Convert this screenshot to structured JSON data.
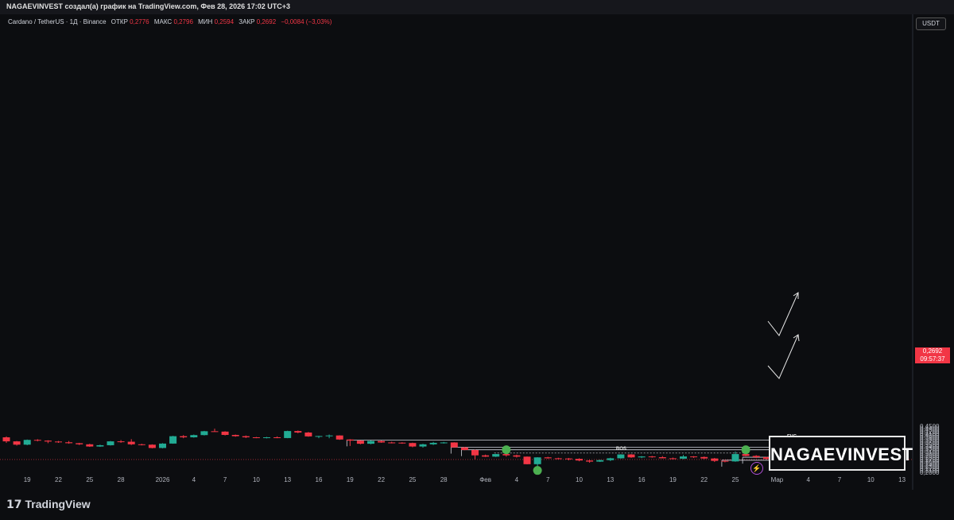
{
  "header": {
    "attribution": "NAGAEVINVEST создал(а) график на TradingView.com, Фев 28, 2026 17:02 UTC+3"
  },
  "legend": {
    "symbol": "Cardano / TetherUS · 1Д · Binance",
    "open_label": "ОТКР",
    "open_value": "0,2776",
    "high_label": "МАКС",
    "high_value": "0,2796",
    "low_label": "МИН",
    "low_value": "0,2594",
    "close_label": "ЗАКР",
    "close_value": "0,2692",
    "change": "−0,0084 (−3,03%)"
  },
  "price_axis": {
    "currency": "USDT",
    "last_price": "0,2692",
    "countdown": "09:57:37"
  },
  "watermark": "NAGAEVINVEST",
  "footer": {
    "brand": "TradingView"
  },
  "colors": {
    "up": "#22ab94",
    "down": "#f23645",
    "background": "#0c0d10",
    "marker": "#4caf50"
  },
  "chart_data": {
    "type": "candlestick",
    "timeframe": "1D",
    "y_ticks": [
      "0,2000",
      "0,2100",
      "0,2200",
      "0,2300",
      "0,2400",
      "0,2500",
      "0,2600",
      "0,2700",
      "0,2800",
      "0,2900",
      "0,3000",
      "0,3100",
      "0,3200",
      "0,3300",
      "0,3400",
      "0,3500",
      "0,3600",
      "0,3700",
      "0,3800",
      "0,3900",
      "0,4000",
      "0,4100",
      "0,4200",
      "0,4300",
      "0,4400",
      "0,4500"
    ],
    "ylim": [
      0.2,
      0.455
    ],
    "x_ticks": [
      {
        "i": 2,
        "label": "19"
      },
      {
        "i": 5,
        "label": "22"
      },
      {
        "i": 8,
        "label": "25"
      },
      {
        "i": 11,
        "label": "28"
      },
      {
        "i": 15,
        "label": "2026"
      },
      {
        "i": 18,
        "label": "4"
      },
      {
        "i": 21,
        "label": "7"
      },
      {
        "i": 24,
        "label": "10"
      },
      {
        "i": 27,
        "label": "13"
      },
      {
        "i": 30,
        "label": "16"
      },
      {
        "i": 33,
        "label": "19"
      },
      {
        "i": 36,
        "label": "22"
      },
      {
        "i": 39,
        "label": "25"
      },
      {
        "i": 42,
        "label": "28"
      },
      {
        "i": 46,
        "label": "Фев"
      },
      {
        "i": 49,
        "label": "4"
      },
      {
        "i": 52,
        "label": "7"
      },
      {
        "i": 55,
        "label": "10"
      },
      {
        "i": 58,
        "label": "13"
      },
      {
        "i": 61,
        "label": "16"
      },
      {
        "i": 64,
        "label": "19"
      },
      {
        "i": 67,
        "label": "22"
      },
      {
        "i": 70,
        "label": "25"
      },
      {
        "i": 74,
        "label": "Мар"
      },
      {
        "i": 77,
        "label": "4"
      },
      {
        "i": 80,
        "label": "7"
      },
      {
        "i": 83,
        "label": "10"
      },
      {
        "i": 86,
        "label": "13"
      }
    ],
    "candles": [
      [
        0.39,
        0.395,
        0.36,
        0.368
      ],
      [
        0.368,
        0.37,
        0.345,
        0.35
      ],
      [
        0.35,
        0.378,
        0.347,
        0.376
      ],
      [
        0.376,
        0.38,
        0.368,
        0.372
      ],
      [
        0.372,
        0.374,
        0.358,
        0.367
      ],
      [
        0.367,
        0.37,
        0.36,
        0.363
      ],
      [
        0.363,
        0.37,
        0.355,
        0.358
      ],
      [
        0.358,
        0.36,
        0.348,
        0.352
      ],
      [
        0.352,
        0.355,
        0.338,
        0.34
      ],
      [
        0.34,
        0.35,
        0.338,
        0.347
      ],
      [
        0.347,
        0.37,
        0.345,
        0.368
      ],
      [
        0.368,
        0.375,
        0.36,
        0.366
      ],
      [
        0.366,
        0.38,
        0.348,
        0.352
      ],
      [
        0.352,
        0.355,
        0.346,
        0.35
      ],
      [
        0.35,
        0.352,
        0.33,
        0.332
      ],
      [
        0.332,
        0.358,
        0.33,
        0.356
      ],
      [
        0.356,
        0.398,
        0.355,
        0.396
      ],
      [
        0.396,
        0.402,
        0.385,
        0.39
      ],
      [
        0.39,
        0.405,
        0.388,
        0.402
      ],
      [
        0.402,
        0.425,
        0.4,
        0.423
      ],
      [
        0.423,
        0.437,
        0.42,
        0.421
      ],
      [
        0.421,
        0.423,
        0.4,
        0.403
      ],
      [
        0.403,
        0.405,
        0.393,
        0.396
      ],
      [
        0.396,
        0.4,
        0.386,
        0.39
      ],
      [
        0.39,
        0.392,
        0.385,
        0.387
      ],
      [
        0.387,
        0.392,
        0.384,
        0.39
      ],
      [
        0.39,
        0.395,
        0.385,
        0.386
      ],
      [
        0.386,
        0.426,
        0.385,
        0.424
      ],
      [
        0.424,
        0.427,
        0.412,
        0.416
      ],
      [
        0.416,
        0.419,
        0.393,
        0.395
      ],
      [
        0.395,
        0.398,
        0.385,
        0.397
      ],
      [
        0.397,
        0.405,
        0.385,
        0.4
      ],
      [
        0.4,
        0.401,
        0.376,
        0.378
      ],
      [
        0.378,
        0.38,
        0.343,
        0.372
      ],
      [
        0.372,
        0.374,
        0.352,
        0.355
      ],
      [
        0.355,
        0.374,
        0.352,
        0.37
      ],
      [
        0.37,
        0.373,
        0.36,
        0.362
      ],
      [
        0.362,
        0.366,
        0.357,
        0.361
      ],
      [
        0.361,
        0.363,
        0.355,
        0.359
      ],
      [
        0.359,
        0.361,
        0.336,
        0.34
      ],
      [
        0.34,
        0.355,
        0.334,
        0.352
      ],
      [
        0.352,
        0.365,
        0.348,
        0.36
      ],
      [
        0.36,
        0.365,
        0.356,
        0.362
      ],
      [
        0.362,
        0.363,
        0.336,
        0.335
      ],
      [
        0.335,
        0.338,
        0.32,
        0.321
      ],
      [
        0.321,
        0.323,
        0.27,
        0.292
      ],
      [
        0.292,
        0.296,
        0.283,
        0.285
      ],
      [
        0.285,
        0.3,
        0.283,
        0.299
      ],
      [
        0.299,
        0.304,
        0.285,
        0.292
      ],
      [
        0.292,
        0.296,
        0.28,
        0.285
      ],
      [
        0.285,
        0.286,
        0.243,
        0.244
      ],
      [
        0.244,
        0.282,
        0.221,
        0.281
      ],
      [
        0.281,
        0.284,
        0.274,
        0.276
      ],
      [
        0.276,
        0.279,
        0.271,
        0.275
      ],
      [
        0.275,
        0.278,
        0.265,
        0.273
      ],
      [
        0.273,
        0.276,
        0.26,
        0.264
      ],
      [
        0.264,
        0.268,
        0.252,
        0.258
      ],
      [
        0.258,
        0.269,
        0.256,
        0.266
      ],
      [
        0.266,
        0.279,
        0.261,
        0.276
      ],
      [
        0.276,
        0.298,
        0.274,
        0.297
      ],
      [
        0.297,
        0.299,
        0.278,
        0.281
      ],
      [
        0.281,
        0.288,
        0.277,
        0.286
      ],
      [
        0.286,
        0.289,
        0.279,
        0.282
      ],
      [
        0.282,
        0.288,
        0.276,
        0.276
      ],
      [
        0.276,
        0.28,
        0.27,
        0.274
      ],
      [
        0.274,
        0.294,
        0.271,
        0.286
      ],
      [
        0.286,
        0.288,
        0.278,
        0.283
      ],
      [
        0.283,
        0.286,
        0.272,
        0.275
      ],
      [
        0.275,
        0.278,
        0.256,
        0.262
      ],
      [
        0.262,
        0.267,
        0.254,
        0.259
      ],
      [
        0.259,
        0.313,
        0.257,
        0.299
      ],
      [
        0.299,
        0.301,
        0.287,
        0.289
      ],
      [
        0.289,
        0.293,
        0.277,
        0.282
      ],
      [
        0.282,
        0.284,
        0.27,
        0.273
      ],
      [
        0.273,
        0.274,
        0.259,
        0.269
      ]
    ],
    "levels": [
      {
        "label": "FVG",
        "price": 0.3755,
        "from": 33
      },
      {
        "label": "FVG",
        "price": 0.336,
        "from": 43
      },
      {
        "label": "FVG",
        "price": 0.3223,
        "from": 44
      },
      {
        "label": "FVG",
        "price": 0.2817,
        "from": 71
      },
      {
        "label": "OB",
        "price": 0.2655,
        "from": 69
      }
    ],
    "bos": {
      "label": "BOS",
      "price": 0.3045,
      "from": 47,
      "to": 71
    },
    "markers": [
      {
        "i": 48,
        "price": 0.3223
      },
      {
        "i": 71,
        "price": 0.3223
      },
      {
        "i": 51,
        "price": 0.21
      }
    ],
    "last_price_line": 0.2692
  }
}
